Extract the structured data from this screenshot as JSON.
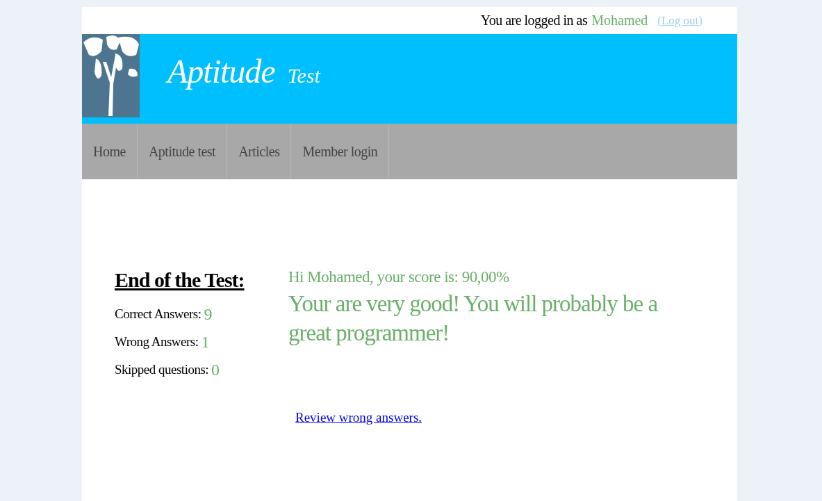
{
  "user_bar": {
    "prefix": "You are logged in as",
    "username": "Mohamed",
    "logout": "(Log out)"
  },
  "header": {
    "title": "Aptitude",
    "subtitle": "Test"
  },
  "nav": [
    "Home",
    "Aptitude test",
    "Articles",
    "Member login"
  ],
  "results": {
    "heading": "End of the Test:",
    "stats": [
      {
        "label": "Correct Answers:",
        "value": "9"
      },
      {
        "label": "Wrong Answers:",
        "value": "1"
      },
      {
        "label": "Skipped questions:",
        "value": "0"
      }
    ],
    "score": "Hi Mohamed, your score is: 90,00%",
    "verdict": "Your are very good! You will probably be a great programmer!",
    "review_link": "Review wrong answers."
  }
}
